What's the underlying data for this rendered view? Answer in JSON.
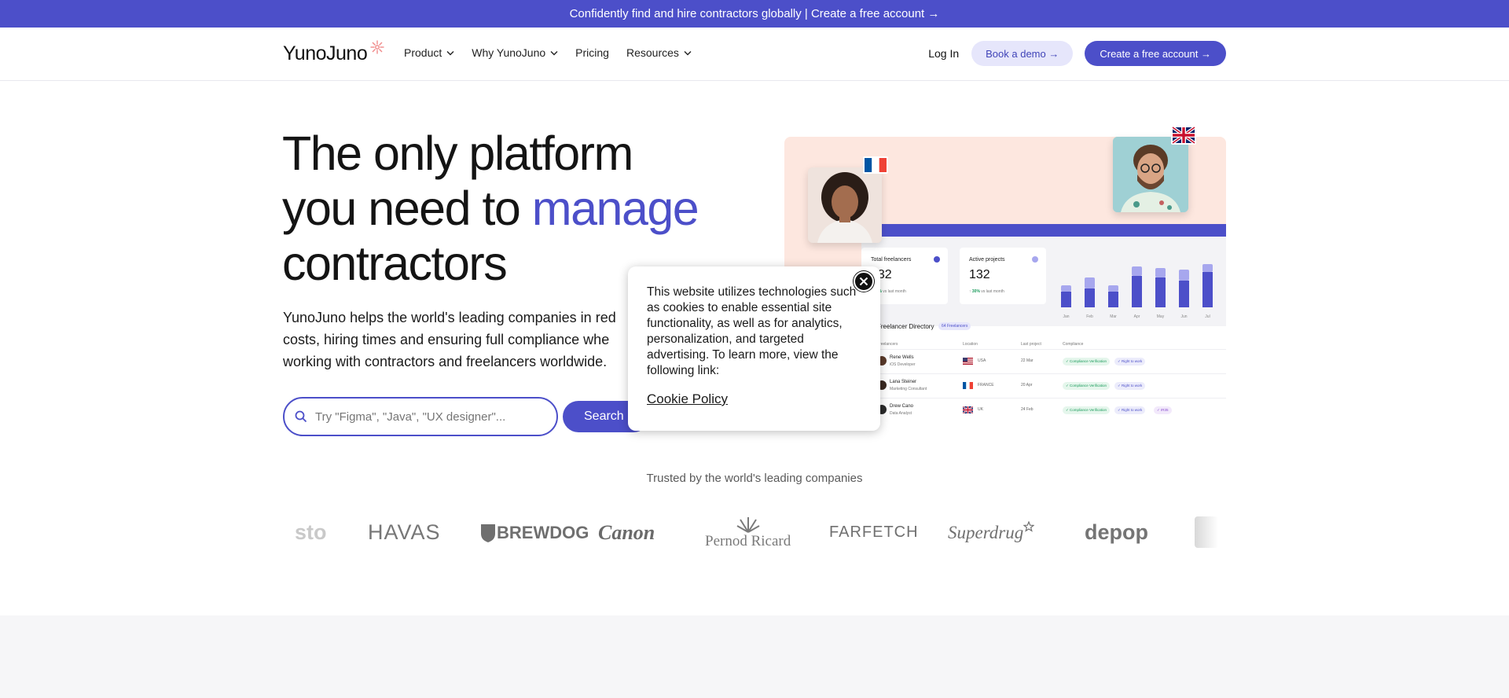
{
  "announcement": {
    "text": "Confidently find and hire contractors globally | Create a free account →"
  },
  "nav": {
    "logo": "YunoJuno",
    "links": [
      {
        "label": "Product",
        "dropdown": true
      },
      {
        "label": "Why YunoJuno",
        "dropdown": true
      },
      {
        "label": "Pricing",
        "dropdown": false
      },
      {
        "label": "Resources",
        "dropdown": true
      }
    ],
    "login": "Log In",
    "demo_button": "Book a demo →",
    "create_button": "Create a free account →"
  },
  "hero": {
    "title_line1": "The only platform",
    "title_line2_plain": "you need to",
    "title_line2_accent": "manage",
    "title_line3": "contractors",
    "subtitle_line1": "YunoJuno helps the world's leading companies in red",
    "subtitle_line2": "costs, hiring times and ensuring full compliance whe",
    "subtitle_line3": "working with contractors and freelancers worldwide.",
    "search_placeholder": "Try \"Figma\", \"Java\", \"UX designer\"...",
    "search_button": "Search"
  },
  "dashboard": {
    "stats": [
      {
        "label": "Total freelancers",
        "value": "532",
        "delta": "40%",
        "delta_text": "vs last month",
        "dot_color": "#4c4fc9"
      },
      {
        "label": "Active projects",
        "value": "132",
        "delta": "30%",
        "delta_text": "vs last month",
        "dot_color": "#a7a7ee"
      }
    ],
    "chart": {
      "months": [
        "Jan",
        "Feb",
        "Mar",
        "Apr",
        "May",
        "Jun",
        "Jul"
      ],
      "dark_values": [
        20,
        24,
        20,
        40,
        38,
        34,
        45
      ],
      "light_values": [
        8,
        14,
        8,
        12,
        12,
        14,
        10
      ]
    },
    "directory_title": "Freelancer Directory",
    "directory_badge": "64 Freelancers",
    "columns": [
      "Freelancers",
      "Location",
      "Last project",
      "Compliance"
    ],
    "rows": [
      {
        "name": "Rene Wells",
        "role": "iOS Developer",
        "location": "USA",
        "date": "22 Mar",
        "pills": [
          "Compliance Verification",
          "Right to work"
        ]
      },
      {
        "name": "Lana Steiner",
        "role": "Marketing Consultant",
        "location": "FRANCE",
        "date": "20 Apr",
        "pills": [
          "Compliance Verification",
          "Right to work"
        ]
      },
      {
        "name": "Drew Cano",
        "role": "Data Analyst",
        "location": "UK",
        "date": "24 Feb",
        "pills": [
          "Compliance Verification",
          "Right to work",
          "IR35"
        ]
      }
    ]
  },
  "cookie": {
    "text": "This website utilizes technologies such as cookies to enable essential site functionality, as well as for analytics, personalization, and targeted advertising. To learn more, view the following link:",
    "link": "Cookie Policy"
  },
  "trusted": {
    "heading": "Trusted by the world's leading companies",
    "logos": [
      "sto",
      "HAVAS",
      "BREWDOG",
      "Canon",
      "Pernod Ricard",
      "FARFETCH",
      "Superdrug",
      "depop"
    ]
  },
  "colors": {
    "brand": "#4c4fc9",
    "brand_light": "#e6e6fb",
    "pink": "#fde7df"
  }
}
